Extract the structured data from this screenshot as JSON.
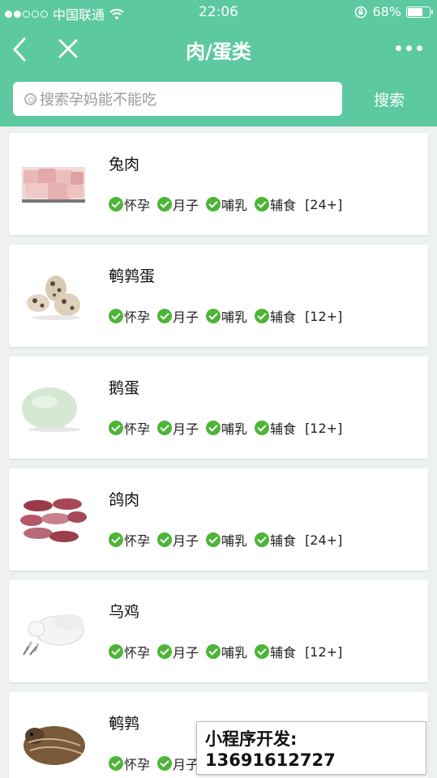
{
  "status_bar": {
    "carrier": "中国联通",
    "time": "22:06",
    "battery": "68%",
    "battery_level": 0.68
  },
  "nav": {
    "title": "肉/蛋类"
  },
  "search": {
    "placeholder": "搜索孕妈能不能吃",
    "button_label": "搜索"
  },
  "tag_labels": [
    "怀孕",
    "月子",
    "哺乳",
    "辅食"
  ],
  "items": [
    {
      "name": "兔肉",
      "age": "[24+]",
      "image_icon": "rabbit-meat-photo"
    },
    {
      "name": "鹌鹑蛋",
      "age": "[12+]",
      "image_icon": "quail-eggs-photo"
    },
    {
      "name": "鹅蛋",
      "age": "[12+]",
      "image_icon": "goose-egg-photo"
    },
    {
      "name": "鸽肉",
      "age": "[24+]",
      "image_icon": "pigeon-meat-photo"
    },
    {
      "name": "乌鸡",
      "age": "[12+]",
      "image_icon": "silkie-chicken-photo"
    },
    {
      "name": "鹌鹑",
      "age": "",
      "image_icon": "quail-bird-photo"
    }
  ],
  "watermark": {
    "text": "小程序开发: 13691612727"
  },
  "colors": {
    "header_green": "#5cc9a1",
    "check_green": "#4db536",
    "background": "#eef1f2"
  }
}
